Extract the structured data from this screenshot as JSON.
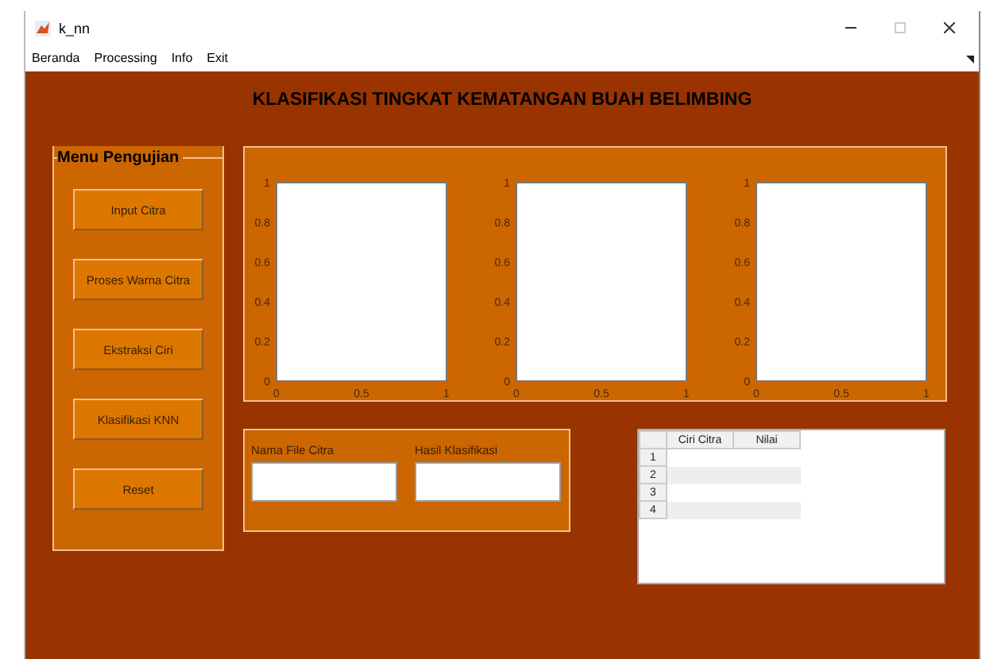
{
  "window": {
    "title": "k_nn"
  },
  "menu_bar": [
    "Beranda",
    "Processing",
    "Info",
    "Exit"
  ],
  "title": "KLASIFIKASI TINGKAT KEMATANGAN BUAH BELIMBING",
  "menu_panel": {
    "title": "Menu Pengujian",
    "buttons": [
      "Input Citra",
      "Proses Warna Citra",
      "Ekstraksi Ciri",
      "Klasifikasi KNN",
      "Reset"
    ]
  },
  "axes": [
    {
      "chart_data": {
        "type": "line",
        "xlim": [
          0,
          1
        ],
        "ylim": [
          0,
          1
        ],
        "xticks": [
          0,
          0.5,
          1
        ],
        "yticks": [
          0,
          0.2,
          0.4,
          0.6,
          0.8,
          1
        ]
      }
    },
    {
      "chart_data": {
        "type": "line",
        "xlim": [
          0,
          1
        ],
        "ylim": [
          0,
          1
        ],
        "xticks": [
          0,
          0.5,
          1
        ],
        "yticks": [
          0,
          0.2,
          0.4,
          0.6,
          0.8,
          1
        ]
      }
    },
    {
      "chart_data": {
        "type": "line",
        "xlim": [
          0,
          1
        ],
        "ylim": [
          0,
          1
        ],
        "xticks": [
          0,
          0.5,
          1
        ],
        "yticks": [
          0,
          0.2,
          0.4,
          0.6,
          0.8,
          1
        ]
      }
    }
  ],
  "fields": [
    {
      "label": "Nama File Citra"
    },
    {
      "label": "Hasil Klasifikasi"
    }
  ],
  "table": {
    "columns": [
      "Ciri Citra",
      "Nilai"
    ],
    "row_headers": [
      "1",
      "2",
      "3",
      "4"
    ]
  }
}
